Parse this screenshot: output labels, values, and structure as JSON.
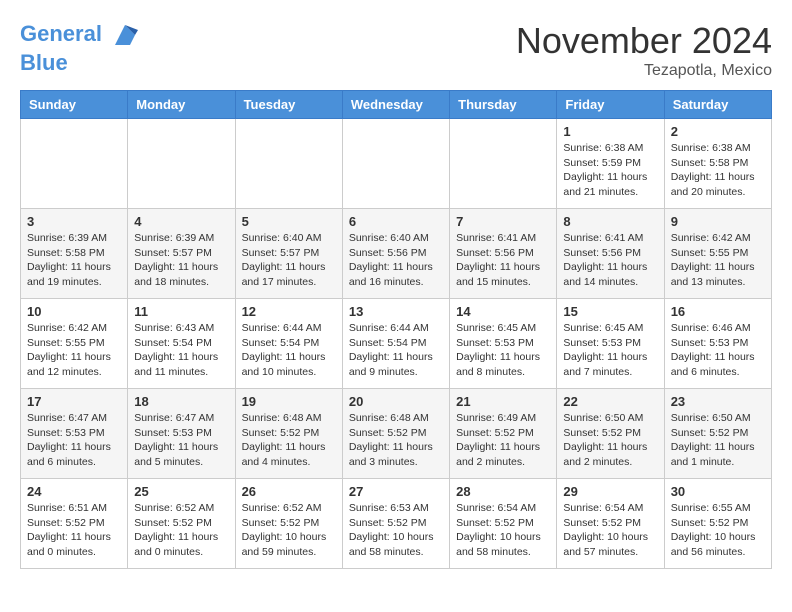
{
  "header": {
    "logo_line1": "General",
    "logo_line2": "Blue",
    "month": "November 2024",
    "location": "Tezapotla, Mexico"
  },
  "weekdays": [
    "Sunday",
    "Monday",
    "Tuesday",
    "Wednesday",
    "Thursday",
    "Friday",
    "Saturday"
  ],
  "weeks": [
    [
      {
        "day": "",
        "info": ""
      },
      {
        "day": "",
        "info": ""
      },
      {
        "day": "",
        "info": ""
      },
      {
        "day": "",
        "info": ""
      },
      {
        "day": "",
        "info": ""
      },
      {
        "day": "1",
        "info": "Sunrise: 6:38 AM\nSunset: 5:59 PM\nDaylight: 11 hours and 21 minutes."
      },
      {
        "day": "2",
        "info": "Sunrise: 6:38 AM\nSunset: 5:58 PM\nDaylight: 11 hours and 20 minutes."
      }
    ],
    [
      {
        "day": "3",
        "info": "Sunrise: 6:39 AM\nSunset: 5:58 PM\nDaylight: 11 hours and 19 minutes."
      },
      {
        "day": "4",
        "info": "Sunrise: 6:39 AM\nSunset: 5:57 PM\nDaylight: 11 hours and 18 minutes."
      },
      {
        "day": "5",
        "info": "Sunrise: 6:40 AM\nSunset: 5:57 PM\nDaylight: 11 hours and 17 minutes."
      },
      {
        "day": "6",
        "info": "Sunrise: 6:40 AM\nSunset: 5:56 PM\nDaylight: 11 hours and 16 minutes."
      },
      {
        "day": "7",
        "info": "Sunrise: 6:41 AM\nSunset: 5:56 PM\nDaylight: 11 hours and 15 minutes."
      },
      {
        "day": "8",
        "info": "Sunrise: 6:41 AM\nSunset: 5:56 PM\nDaylight: 11 hours and 14 minutes."
      },
      {
        "day": "9",
        "info": "Sunrise: 6:42 AM\nSunset: 5:55 PM\nDaylight: 11 hours and 13 minutes."
      }
    ],
    [
      {
        "day": "10",
        "info": "Sunrise: 6:42 AM\nSunset: 5:55 PM\nDaylight: 11 hours and 12 minutes."
      },
      {
        "day": "11",
        "info": "Sunrise: 6:43 AM\nSunset: 5:54 PM\nDaylight: 11 hours and 11 minutes."
      },
      {
        "day": "12",
        "info": "Sunrise: 6:44 AM\nSunset: 5:54 PM\nDaylight: 11 hours and 10 minutes."
      },
      {
        "day": "13",
        "info": "Sunrise: 6:44 AM\nSunset: 5:54 PM\nDaylight: 11 hours and 9 minutes."
      },
      {
        "day": "14",
        "info": "Sunrise: 6:45 AM\nSunset: 5:53 PM\nDaylight: 11 hours and 8 minutes."
      },
      {
        "day": "15",
        "info": "Sunrise: 6:45 AM\nSunset: 5:53 PM\nDaylight: 11 hours and 7 minutes."
      },
      {
        "day": "16",
        "info": "Sunrise: 6:46 AM\nSunset: 5:53 PM\nDaylight: 11 hours and 6 minutes."
      }
    ],
    [
      {
        "day": "17",
        "info": "Sunrise: 6:47 AM\nSunset: 5:53 PM\nDaylight: 11 hours and 6 minutes."
      },
      {
        "day": "18",
        "info": "Sunrise: 6:47 AM\nSunset: 5:53 PM\nDaylight: 11 hours and 5 minutes."
      },
      {
        "day": "19",
        "info": "Sunrise: 6:48 AM\nSunset: 5:52 PM\nDaylight: 11 hours and 4 minutes."
      },
      {
        "day": "20",
        "info": "Sunrise: 6:48 AM\nSunset: 5:52 PM\nDaylight: 11 hours and 3 minutes."
      },
      {
        "day": "21",
        "info": "Sunrise: 6:49 AM\nSunset: 5:52 PM\nDaylight: 11 hours and 2 minutes."
      },
      {
        "day": "22",
        "info": "Sunrise: 6:50 AM\nSunset: 5:52 PM\nDaylight: 11 hours and 2 minutes."
      },
      {
        "day": "23",
        "info": "Sunrise: 6:50 AM\nSunset: 5:52 PM\nDaylight: 11 hours and 1 minute."
      }
    ],
    [
      {
        "day": "24",
        "info": "Sunrise: 6:51 AM\nSunset: 5:52 PM\nDaylight: 11 hours and 0 minutes."
      },
      {
        "day": "25",
        "info": "Sunrise: 6:52 AM\nSunset: 5:52 PM\nDaylight: 11 hours and 0 minutes."
      },
      {
        "day": "26",
        "info": "Sunrise: 6:52 AM\nSunset: 5:52 PM\nDaylight: 10 hours and 59 minutes."
      },
      {
        "day": "27",
        "info": "Sunrise: 6:53 AM\nSunset: 5:52 PM\nDaylight: 10 hours and 58 minutes."
      },
      {
        "day": "28",
        "info": "Sunrise: 6:54 AM\nSunset: 5:52 PM\nDaylight: 10 hours and 58 minutes."
      },
      {
        "day": "29",
        "info": "Sunrise: 6:54 AM\nSunset: 5:52 PM\nDaylight: 10 hours and 57 minutes."
      },
      {
        "day": "30",
        "info": "Sunrise: 6:55 AM\nSunset: 5:52 PM\nDaylight: 10 hours and 56 minutes."
      }
    ]
  ]
}
